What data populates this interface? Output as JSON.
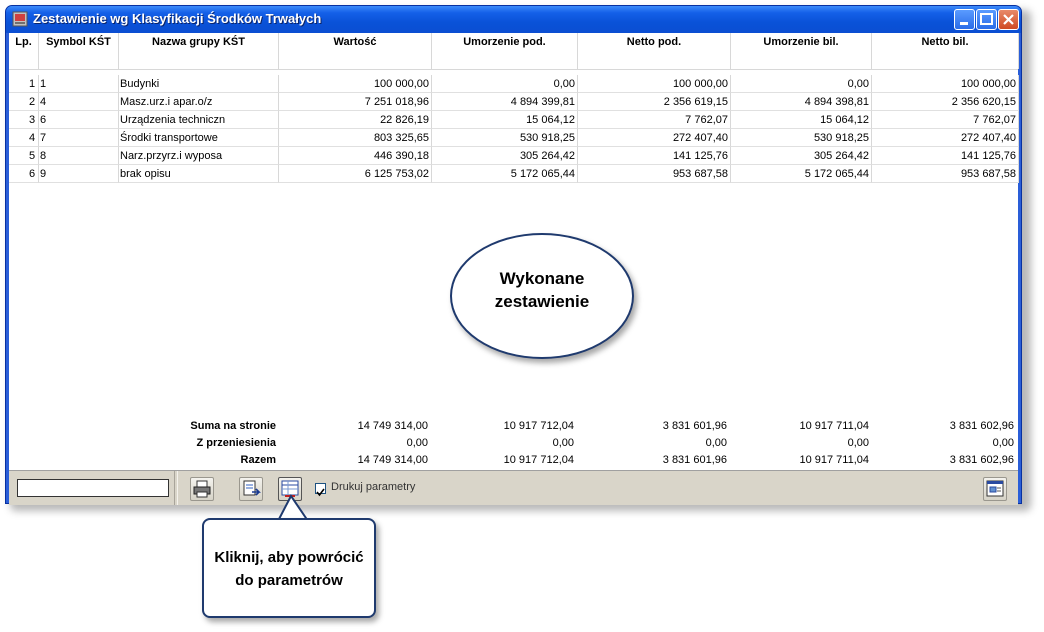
{
  "window": {
    "title": "Zestawienie wg Klasyfikacji Środków Trwałych"
  },
  "columns": [
    "Lp.",
    "Symbol KŚT",
    "Nazwa grupy KŚT",
    "Wartość",
    "Umorzenie pod.",
    "Netto pod.",
    "Umorzenie bil.",
    "Netto bil."
  ],
  "rows": [
    {
      "lp": "1",
      "symbol": "1",
      "name": "Budynki",
      "wartosc": "100 000,00",
      "umorz_pod": "0,00",
      "netto_pod": "100 000,00",
      "umorz_bil": "0,00",
      "netto_bil": "100 000,00"
    },
    {
      "lp": "2",
      "symbol": "4",
      "name": "Masz.urz.i apar.o/z",
      "wartosc": "7 251 018,96",
      "umorz_pod": "4 894 399,81",
      "netto_pod": "2 356 619,15",
      "umorz_bil": "4 894 398,81",
      "netto_bil": "2 356 620,15"
    },
    {
      "lp": "3",
      "symbol": "6",
      "name": "Urządzenia techniczn",
      "wartosc": "22 826,19",
      "umorz_pod": "15 064,12",
      "netto_pod": "7 762,07",
      "umorz_bil": "15 064,12",
      "netto_bil": "7 762,07"
    },
    {
      "lp": "4",
      "symbol": "7",
      "name": "Środki transportowe",
      "wartosc": "803 325,65",
      "umorz_pod": "530 918,25",
      "netto_pod": "272 407,40",
      "umorz_bil": "530 918,25",
      "netto_bil": "272 407,40"
    },
    {
      "lp": "5",
      "symbol": "8",
      "name": "Narz.przyrz.i wyposa",
      "wartosc": "446 390,18",
      "umorz_pod": "305 264,42",
      "netto_pod": "141 125,76",
      "umorz_bil": "305 264,42",
      "netto_bil": "141 125,76"
    },
    {
      "lp": "6",
      "symbol": "9",
      "name": "brak opisu",
      "wartosc": "6 125 753,02",
      "umorz_pod": "5 172 065,44",
      "netto_pod": "953 687,58",
      "umorz_bil": "5 172 065,44",
      "netto_bil": "953 687,58"
    }
  ],
  "summary": [
    {
      "label": "Suma na stronie",
      "wartosc": "14 749 314,00",
      "umorz_pod": "10 917 712,04",
      "netto_pod": "3 831 601,96",
      "umorz_bil": "10 917 711,04",
      "netto_bil": "3 831 602,96"
    },
    {
      "label": "Z przeniesienia",
      "wartosc": "0,00",
      "umorz_pod": "0,00",
      "netto_pod": "0,00",
      "umorz_bil": "0,00",
      "netto_bil": "0,00"
    },
    {
      "label": "Razem",
      "wartosc": "14 749 314,00",
      "umorz_pod": "10 917 712,04",
      "netto_pod": "3 831 601,96",
      "umorz_bil": "10 917 711,04",
      "netto_bil": "3 831 602,96"
    }
  ],
  "toolbar": {
    "search_value": "",
    "print_parameters_label": "Drukuj parametry",
    "print_parameters_checked": true,
    "icons": [
      "printer-icon",
      "export-icon",
      "back-to-parameters-icon",
      "view-icon"
    ]
  },
  "callouts": {
    "ellipse_line1": "Wykonane",
    "ellipse_line2": "zestawienie",
    "box_line1": "Kliknij, aby powrócić",
    "box_line2": "do parametrów"
  },
  "colors": {
    "titlebar": "#0a52d8",
    "toolbar": "#d9d5c9",
    "callout_border": "#1f3a6e"
  }
}
